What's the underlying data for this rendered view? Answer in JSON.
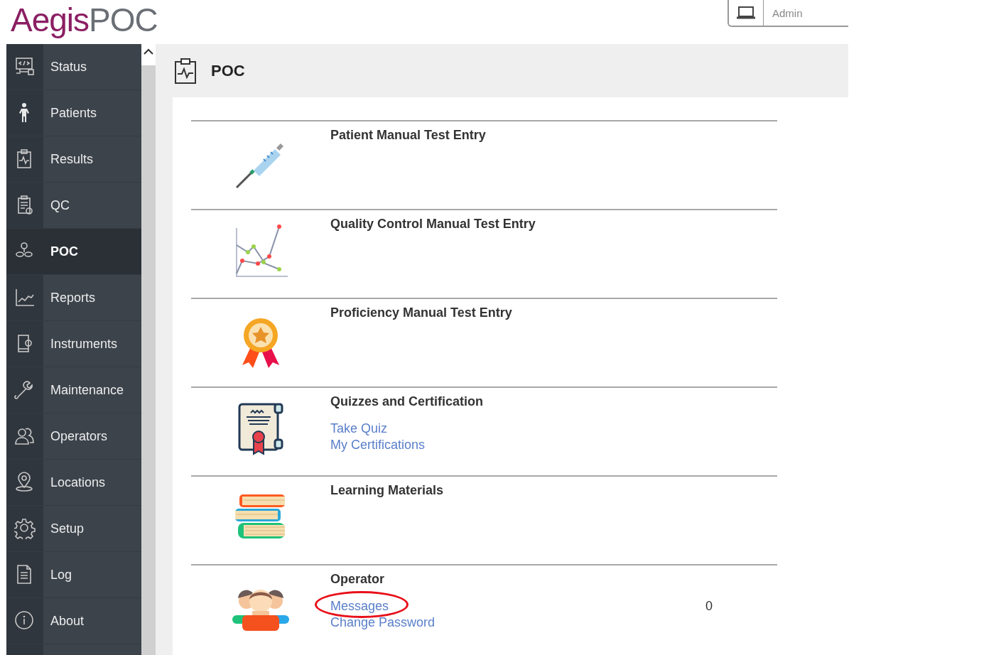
{
  "logo": [
    "Aegis",
    "POC"
  ],
  "user": {
    "name": "Admin"
  },
  "sidebar": {
    "items": [
      {
        "label": "Status",
        "selected": false
      },
      {
        "label": "Patients",
        "selected": false
      },
      {
        "label": "Results",
        "selected": false
      },
      {
        "label": "QC",
        "selected": false
      },
      {
        "label": "POC",
        "selected": true
      },
      {
        "label": "Reports",
        "selected": false
      },
      {
        "label": "Instruments",
        "selected": false
      },
      {
        "label": "Maintenance",
        "selected": false
      },
      {
        "label": "Operators",
        "selected": false
      },
      {
        "label": "Locations",
        "selected": false
      },
      {
        "label": "Setup",
        "selected": false
      },
      {
        "label": "Log",
        "selected": false
      },
      {
        "label": "About",
        "selected": false
      }
    ]
  },
  "page": {
    "title": "POC"
  },
  "sections": [
    {
      "title": "Patient Manual Test Entry"
    },
    {
      "title": "Quality Control Manual Test Entry"
    },
    {
      "title": "Proficiency Manual Test Entry"
    },
    {
      "title": "Quizzes and Certification",
      "links": [
        {
          "label": "Take Quiz",
          "circled": false
        },
        {
          "label": "My Certifications",
          "circled": false
        }
      ]
    },
    {
      "title": "Learning Materials"
    },
    {
      "title": "Operator",
      "links": [
        {
          "label": "Messages",
          "circled": true,
          "count": "0"
        },
        {
          "label": "Change Password",
          "circled": false
        }
      ]
    }
  ]
}
